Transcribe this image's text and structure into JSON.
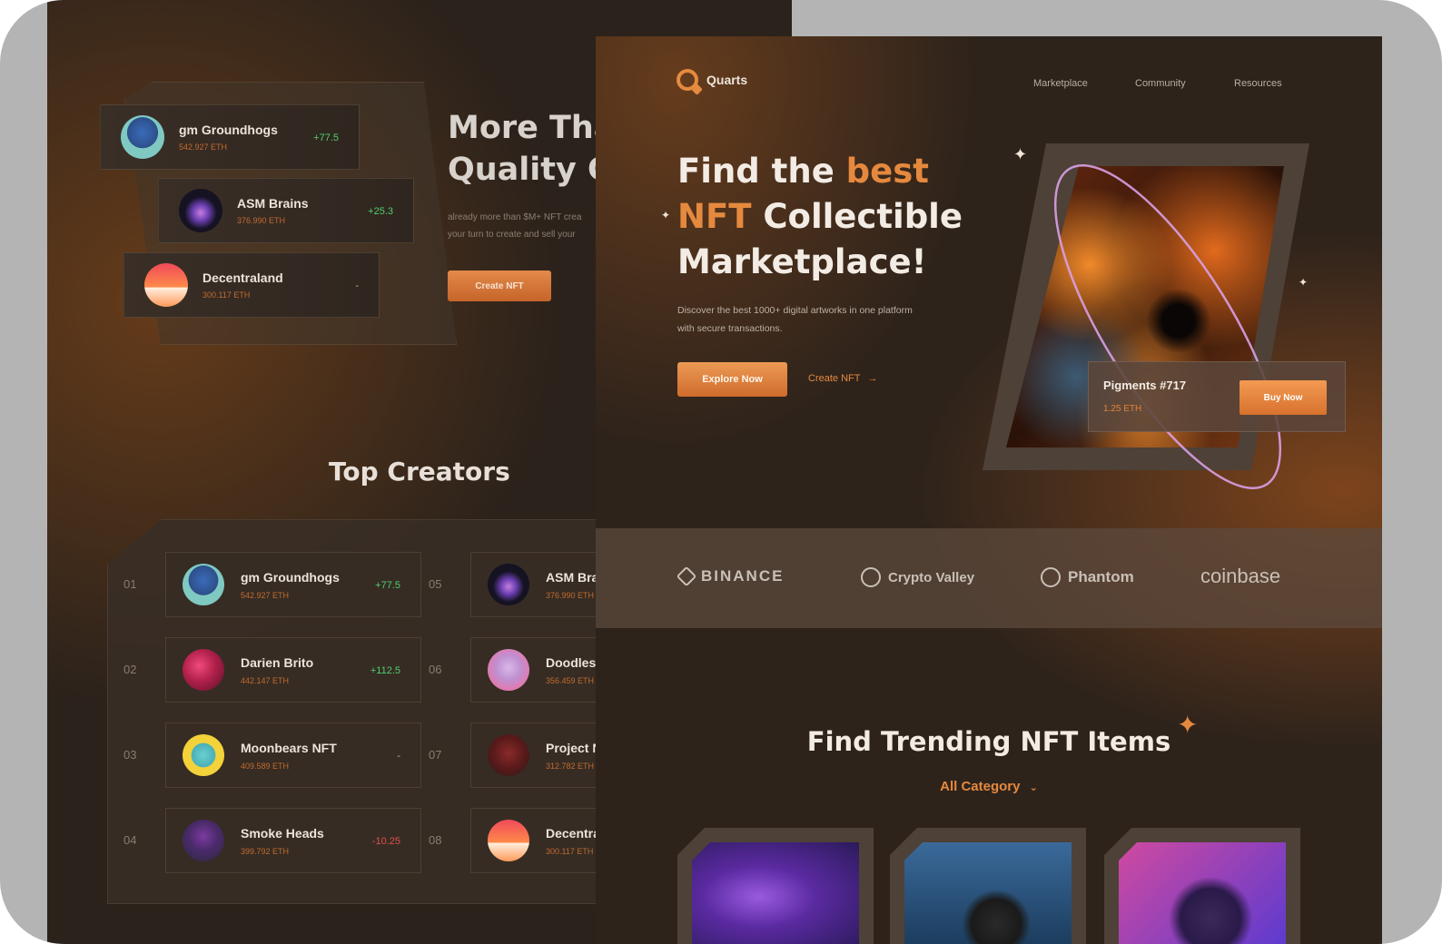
{
  "back_screen": {
    "hero_title": "More Tha\nQuality C",
    "hero_desc": "already more than $M+ NFT crea\nyour turn to create and sell your",
    "create_button": "Create NFT",
    "stack_cards": [
      {
        "name": "gm Groundhogs",
        "eth": "542.927 ETH",
        "change": "+77.5",
        "trend": "pos"
      },
      {
        "name": "ASM Brains",
        "eth": "376.990 ETH",
        "change": "+25.3",
        "trend": "pos"
      },
      {
        "name": "Decentraland",
        "eth": "300.117 ETH",
        "change": "-",
        "trend": "neu"
      }
    ],
    "top_creators_title": "Top Creators",
    "creators": [
      {
        "rank": "01",
        "name": "gm Groundhogs",
        "eth": "542.927 ETH",
        "change": "+77.5",
        "trend": "pos"
      },
      {
        "rank": "02",
        "name": "Darien Brito",
        "eth": "442.147 ETH",
        "change": "+112.5",
        "trend": "pos"
      },
      {
        "rank": "03",
        "name": "Moonbears NFT",
        "eth": "409.589 ETH",
        "change": "-",
        "trend": "neu"
      },
      {
        "rank": "04",
        "name": "Smoke Heads",
        "eth": "399.792 ETH",
        "change": "-10.25",
        "trend": "neg"
      },
      {
        "rank": "05",
        "name": "ASM Brain",
        "eth": "376.990 ETH",
        "change": "",
        "trend": "pos"
      },
      {
        "rank": "06",
        "name": "Doodles",
        "eth": "356.459 ETH",
        "change": "",
        "trend": "pos"
      },
      {
        "rank": "07",
        "name": "Project NA",
        "eth": "312.782 ETH",
        "change": "",
        "trend": "pos"
      },
      {
        "rank": "08",
        "name": "Decentrala",
        "eth": "300.117 ETH",
        "change": "",
        "trend": "pos"
      }
    ]
  },
  "front_screen": {
    "brand": "Quarts",
    "nav": [
      "Marketplace",
      "Community",
      "Resources"
    ],
    "headline": {
      "line1_a": "Find the ",
      "line1_b": "best",
      "line2_a": "NFT",
      "line2_b": " Collectible",
      "line3": "Marketplace!"
    },
    "subtitle": "Discover the best 1000+ digital artworks in one platform with secure transactions.",
    "explore_button": "Explore Now",
    "create_link": "Create NFT",
    "featured": {
      "name": "Pigments #717",
      "eth": "1.25 ETH",
      "buy_button": "Buy Now"
    },
    "partners": [
      "BINANCE",
      "Crypto Valley",
      "Phantom",
      "coinbase"
    ],
    "trending_title": "Find Trending NFT Items",
    "category": "All Category"
  },
  "colors": {
    "accent": "#e5893e",
    "positive": "#4fcf6a",
    "negative": "#e0524a",
    "background": "#2e231b"
  }
}
